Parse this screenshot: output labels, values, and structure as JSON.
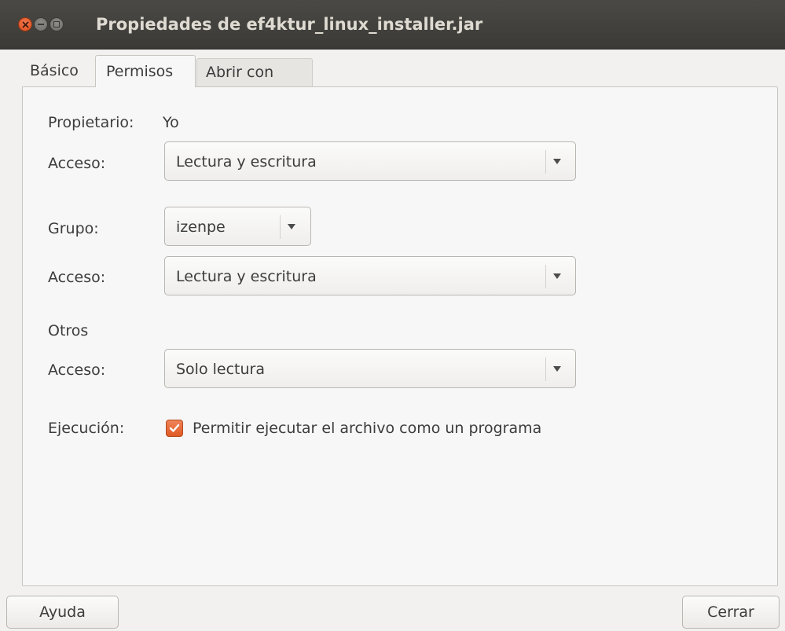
{
  "window": {
    "title": "Propiedades de ef4ktur_linux_installer.jar"
  },
  "tabs": [
    {
      "label": "Básico",
      "selected": false
    },
    {
      "label": "Permisos",
      "selected": true
    },
    {
      "label": "Abrir con",
      "selected": false
    }
  ],
  "permissions": {
    "owner": {
      "label": "Propietario:",
      "value": "Yo",
      "access_label": "Acceso:",
      "access_value": "Lectura y escritura"
    },
    "group": {
      "label": "Grupo:",
      "value": "izenpe",
      "access_label": "Acceso:",
      "access_value": "Lectura y escritura"
    },
    "others": {
      "label": "Otros",
      "access_label": "Acceso:",
      "access_value": "Solo lectura"
    },
    "execution": {
      "label": "Ejecución:",
      "checkbox_label": "Permitir ejecutar el archivo como un programa",
      "checked": true
    }
  },
  "buttons": {
    "help": "Ayuda",
    "close": "Cerrar"
  },
  "colors": {
    "accent": "#e05a24",
    "titlebar": "#3b3a36",
    "title_text": "#dfdbd2"
  }
}
